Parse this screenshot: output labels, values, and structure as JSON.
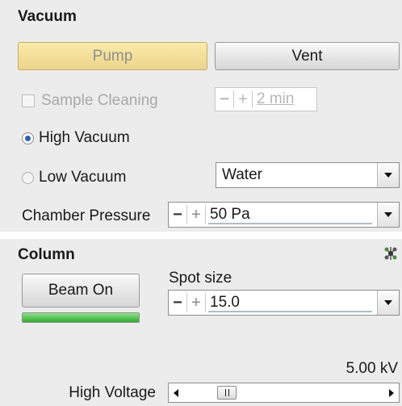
{
  "vacuum": {
    "title": "Vacuum",
    "pump_label": "Pump",
    "vent_label": "Vent",
    "sample_cleaning_label": "Sample Cleaning",
    "cleaning_time_value": "2 min",
    "high_vacuum_label": "High Vacuum",
    "low_vacuum_label": "Low Vacuum",
    "selected_mode": "High Vacuum",
    "gas_selected": "Water",
    "chamber_pressure_label": "Chamber Pressure",
    "chamber_pressure_value": "50 Pa",
    "accent_pump": "#f3e3a2"
  },
  "column": {
    "title": "Column",
    "settings_icon": "molecule-icon",
    "beam_on_label": "Beam On",
    "beam_status_color": "#3bbf3b",
    "spot_size_label": "Spot size",
    "spot_size_value": "15.0",
    "high_voltage_label": "High Voltage",
    "high_voltage_value": "5.00 kV"
  }
}
